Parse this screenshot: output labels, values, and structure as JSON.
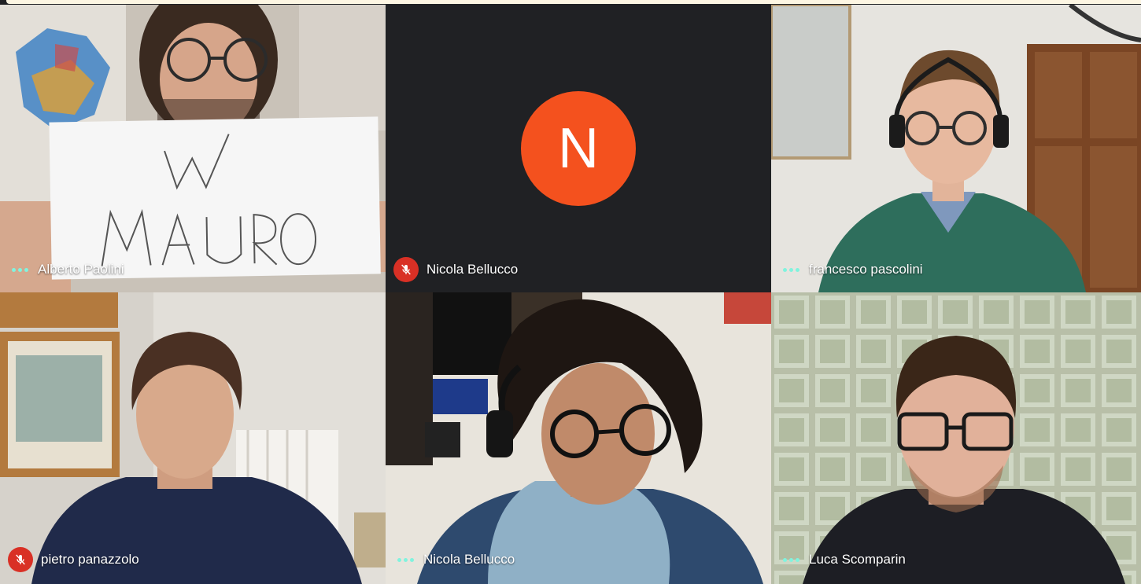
{
  "participants": [
    {
      "name": "Alberto Paolini",
      "muted": false,
      "video": true
    },
    {
      "name": "Nicola Bellucco",
      "muted": true,
      "video": false,
      "avatar_letter": "N"
    },
    {
      "name": "francesco pascolini",
      "muted": false,
      "video": true
    },
    {
      "name": "pietro panazzolo",
      "muted": true,
      "video": true
    },
    {
      "name": "Nicola Bellucco",
      "muted": false,
      "video": true
    },
    {
      "name": "Luca Scomparin",
      "muted": false,
      "video": true
    }
  ],
  "sign_text": [
    "W",
    "MAURO"
  ],
  "colors": {
    "background": "#202124",
    "avatar": "#f4511e",
    "mute_badge": "#d93025",
    "speaking_dots": "#81f3de"
  },
  "icons": {
    "mute": "mic-off-icon",
    "audio_level": "audio-level-icon"
  }
}
